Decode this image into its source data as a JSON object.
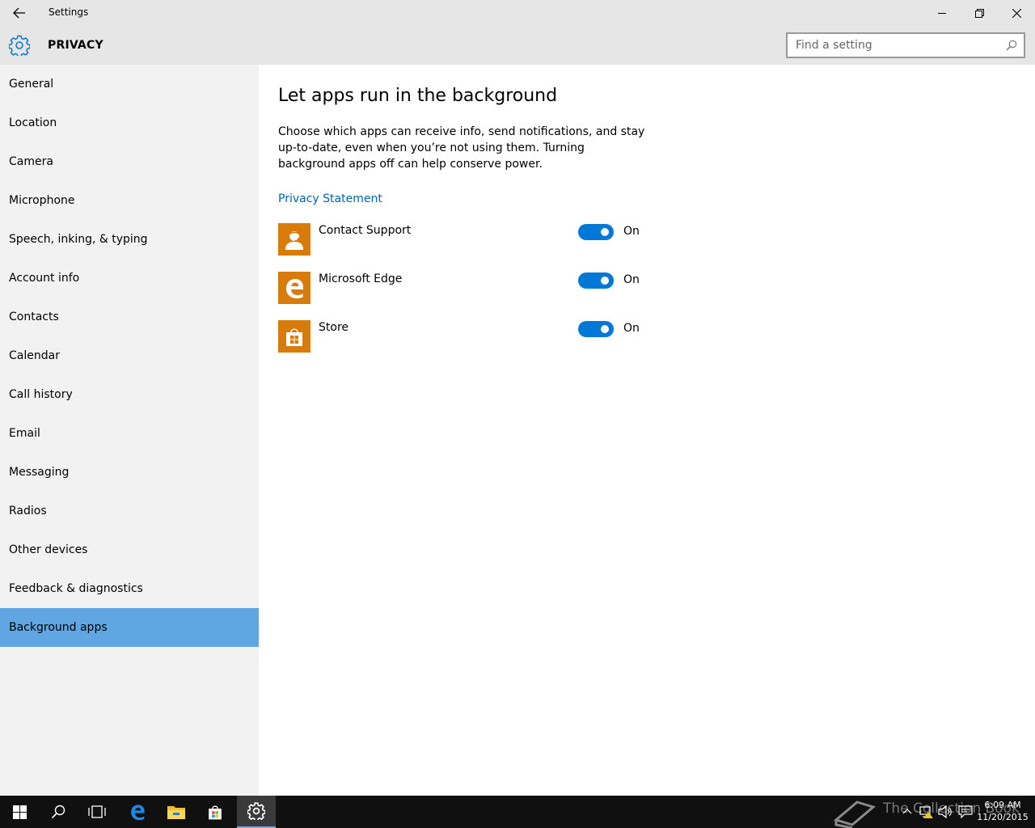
{
  "window": {
    "title": "Settings",
    "section": "PRIVACY"
  },
  "search": {
    "placeholder": "Find a setting"
  },
  "sidebar": {
    "items": [
      {
        "label": "General"
      },
      {
        "label": "Location"
      },
      {
        "label": "Camera"
      },
      {
        "label": "Microphone"
      },
      {
        "label": "Speech, inking, & typing"
      },
      {
        "label": "Account info"
      },
      {
        "label": "Contacts"
      },
      {
        "label": "Calendar"
      },
      {
        "label": "Call history"
      },
      {
        "label": "Email"
      },
      {
        "label": "Messaging"
      },
      {
        "label": "Radios"
      },
      {
        "label": "Other devices"
      },
      {
        "label": "Feedback & diagnostics"
      },
      {
        "label": "Background apps",
        "selected": true
      }
    ]
  },
  "main": {
    "title": "Let apps run in the background",
    "description": "Choose which apps can receive info, send notifications, and stay up-to-date, even when you’re not using them. Turning background apps off can help conserve power.",
    "privacy_link": "Privacy Statement",
    "apps": [
      {
        "name": "Contact Support",
        "icon": "contact-support-icon",
        "toggle": "On",
        "enabled": true
      },
      {
        "name": "Microsoft Edge",
        "icon": "edge-icon",
        "toggle": "On",
        "enabled": true
      },
      {
        "name": "Store",
        "icon": "store-icon",
        "toggle": "On",
        "enabled": true
      }
    ]
  },
  "taskbar": {
    "time": "6:09 AM",
    "date": "11/20/2015",
    "watermark": "The Collection Book"
  },
  "colors": {
    "accent": "#0078d7",
    "selected_nav": "#5fa6e2",
    "app_tile": "#d97b0b",
    "link": "#0063b1",
    "chrome": "#e6e6e6",
    "sidebar": "#f2f2f2",
    "taskbar": "#101010"
  }
}
